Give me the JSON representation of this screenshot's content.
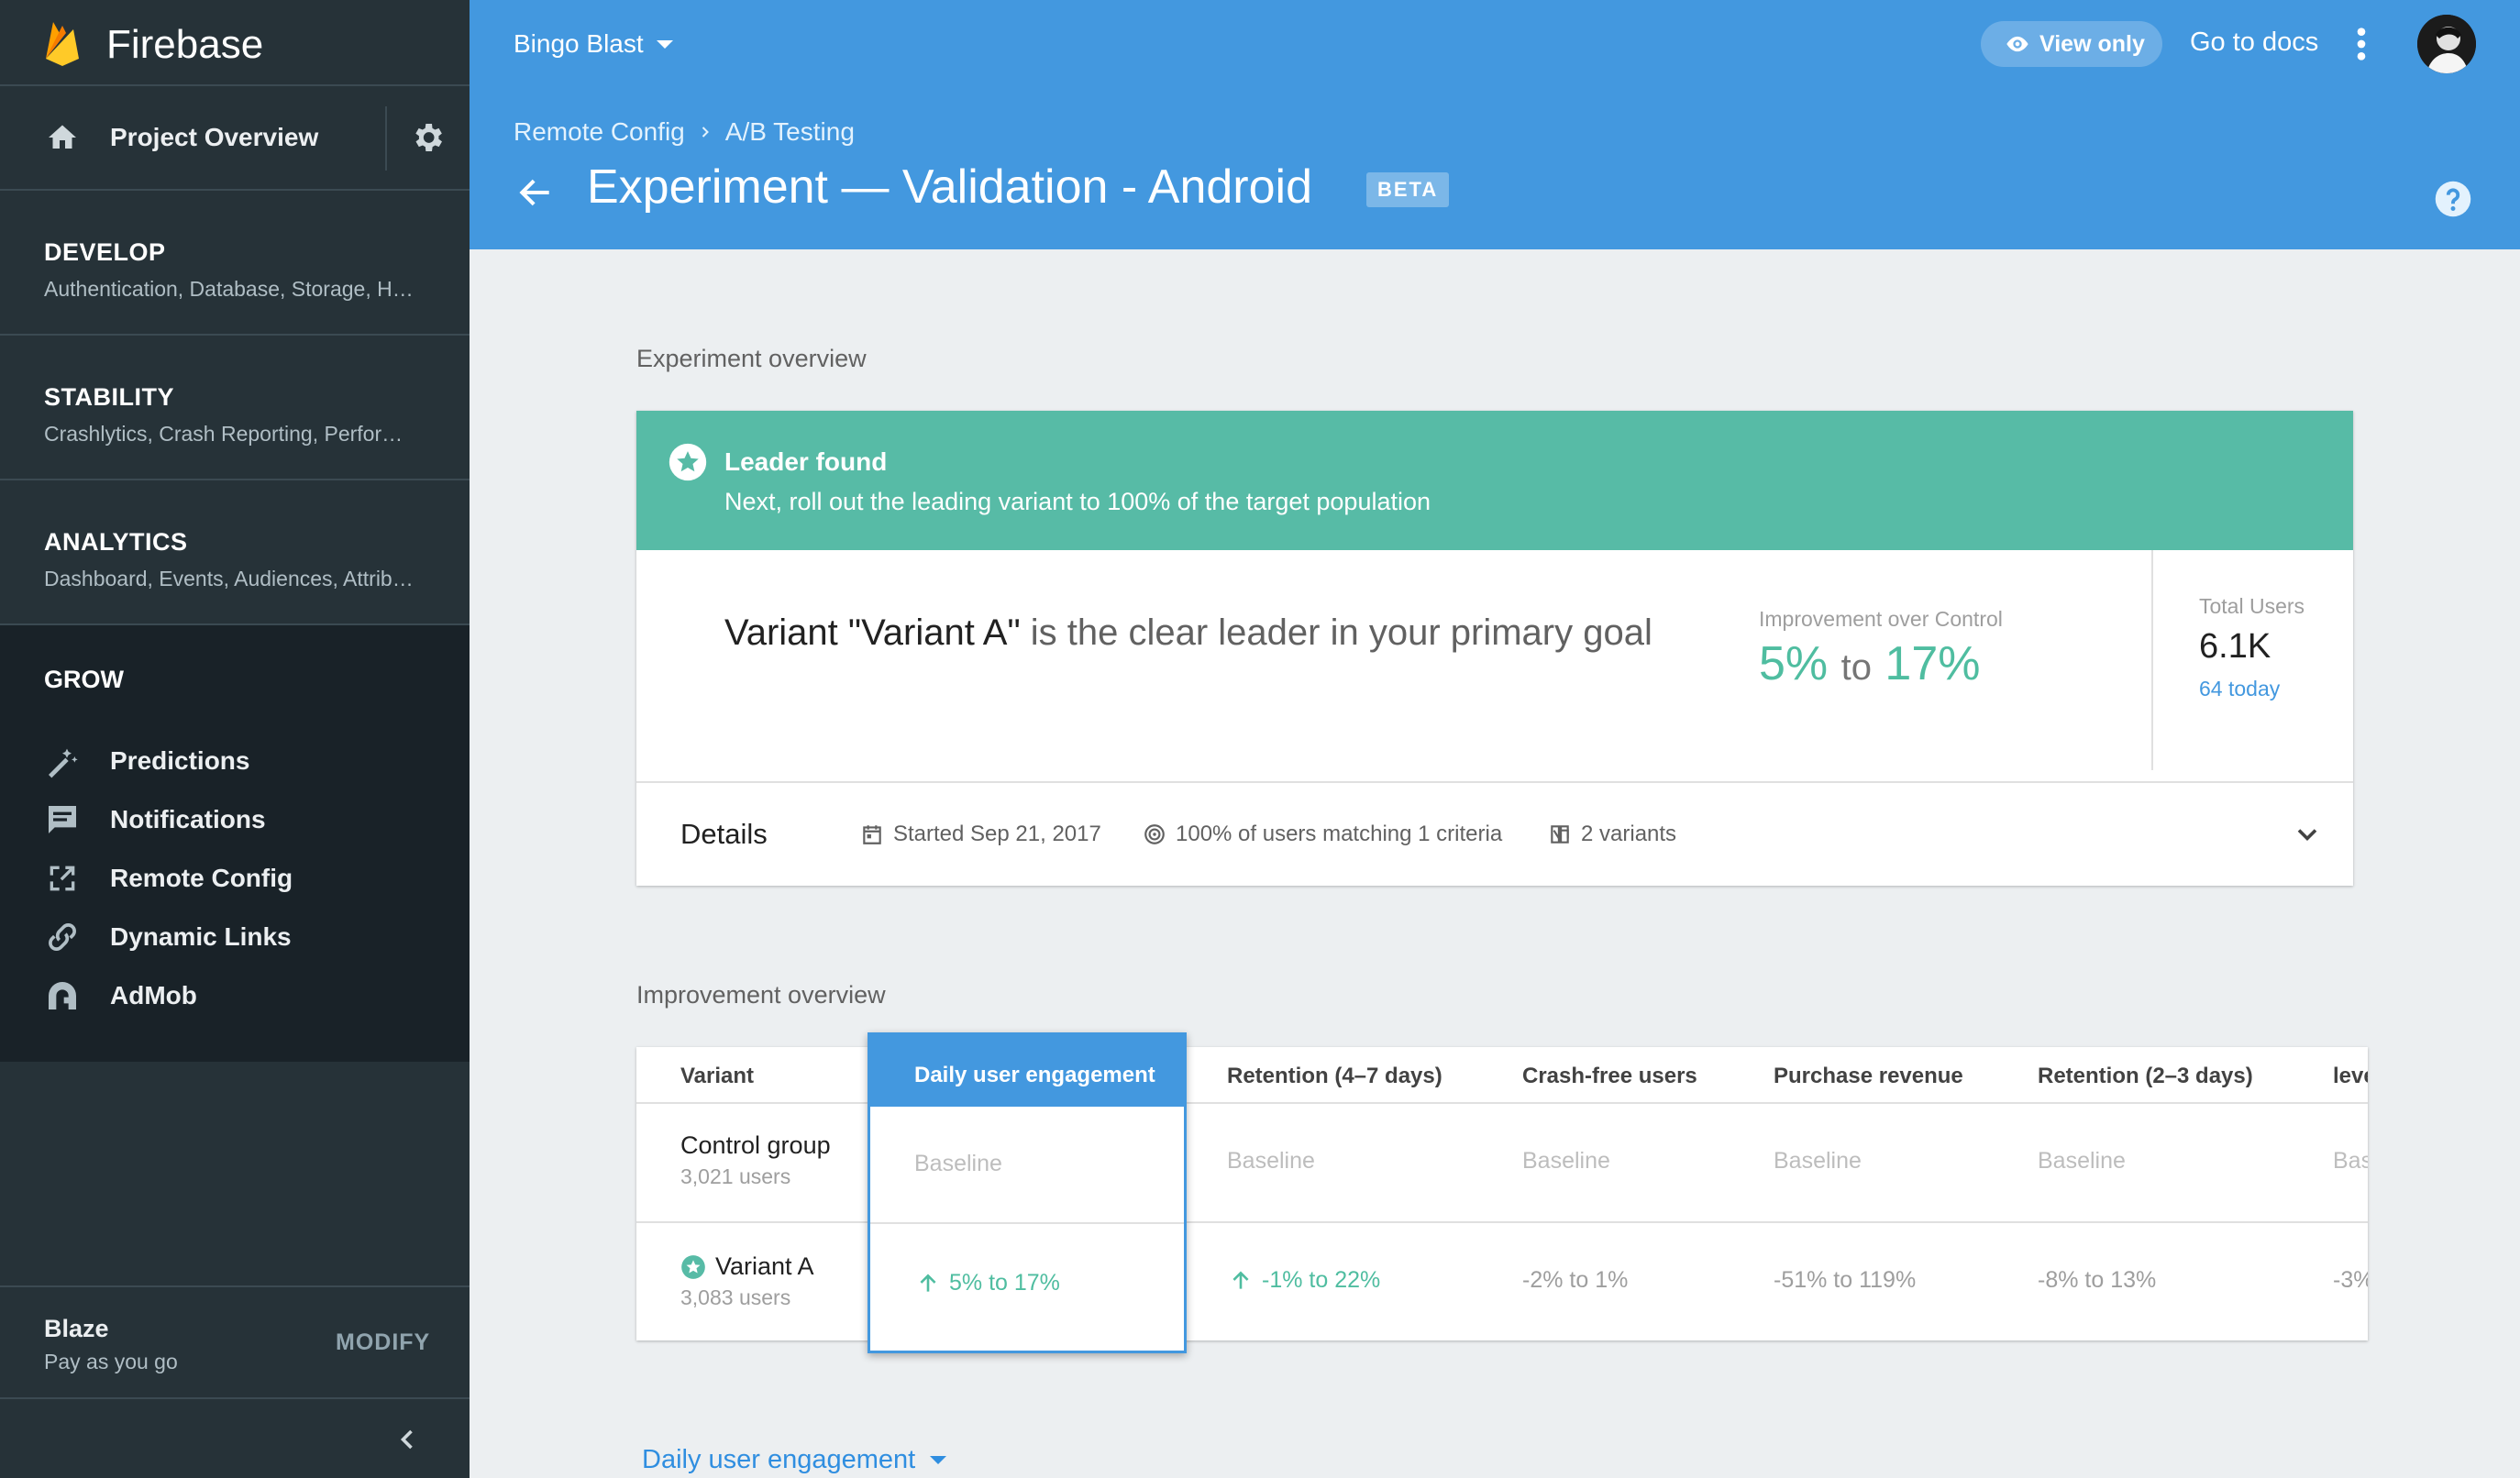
{
  "app": {
    "name": "Firebase",
    "project_overview": "Project Overview"
  },
  "sidebar": {
    "sections": [
      {
        "title": "DEVELOP",
        "subtitle": "Authentication, Database, Storage, H…"
      },
      {
        "title": "STABILITY",
        "subtitle": "Crashlytics, Crash Reporting, Perfor…"
      },
      {
        "title": "ANALYTICS",
        "subtitle": "Dashboard, Events, Audiences, Attrib…"
      }
    ],
    "grow": {
      "title": "GROW",
      "items": [
        {
          "label": "Predictions",
          "icon": "magic-wand-icon"
        },
        {
          "label": "Notifications",
          "icon": "message-icon"
        },
        {
          "label": "Remote Config",
          "icon": "remote-config-icon"
        },
        {
          "label": "Dynamic Links",
          "icon": "link-icon"
        },
        {
          "label": "AdMob",
          "icon": "admob-icon"
        }
      ]
    },
    "plan": {
      "name": "Blaze",
      "description": "Pay as you go",
      "action": "MODIFY"
    }
  },
  "header": {
    "project": "Bingo Blast",
    "view_only": "View only",
    "docs": "Go to docs",
    "breadcrumb": [
      "Remote Config",
      "A/B Testing"
    ],
    "title": "Experiment — Validation - Android",
    "badge": "BETA"
  },
  "overview": {
    "section_title": "Experiment overview",
    "banner_title": "Leader found",
    "banner_text": "Next, roll out the leading variant to 100% of the target population",
    "leader_variant": "Variant \"Variant A\"",
    "leader_rest": "is the clear leader in your primary goal",
    "improvement_label": "Improvement over Control",
    "improvement_low": "5%",
    "improvement_to": "to",
    "improvement_high": "17%",
    "total_users_label": "Total Users",
    "total_users": "6.1K",
    "today": "64 today",
    "details_label": "Details",
    "started": "Started Sep 21, 2017",
    "targeting": "100% of users matching 1 criteria",
    "variants": "2 variants"
  },
  "improvement": {
    "section_title": "Improvement overview",
    "columns": [
      "Variant",
      "Daily user engagement",
      "Retention (4–7 days)",
      "Crash-free users",
      "Purchase revenue",
      "Retention (2–3 days)",
      "leve"
    ],
    "rows": [
      {
        "name": "Control group",
        "users": "3,021 users",
        "cells": [
          "Baseline",
          "Baseline",
          "Baseline",
          "Baseline",
          "Baseline",
          "Bas"
        ]
      },
      {
        "name": "Variant A",
        "users": "3,083 users",
        "cells": [
          "5% to 17%",
          "-1% to 22%",
          "-2% to 1%",
          "-51% to 119%",
          "-8% to 13%",
          "-3%"
        ]
      }
    ]
  },
  "metric_selector": "Daily user engagement",
  "colors": {
    "header": "#4398df",
    "sidebar": "#263238",
    "accent_green": "#57bba6",
    "positive": "#4fbda0"
  }
}
